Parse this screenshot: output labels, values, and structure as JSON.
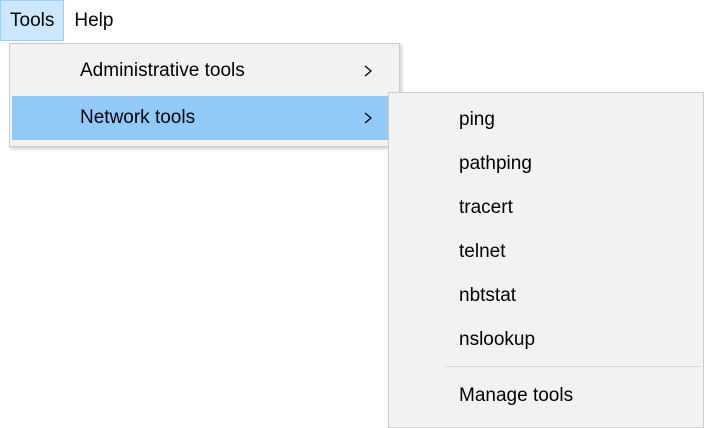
{
  "menubar": {
    "items": [
      {
        "label": "Tools",
        "active": true
      },
      {
        "label": "Help",
        "active": false
      }
    ]
  },
  "tools_menu": {
    "items": [
      {
        "label": "Administrative tools",
        "has_submenu": true,
        "highlighted": false
      },
      {
        "label": "Network tools",
        "has_submenu": true,
        "highlighted": true
      }
    ]
  },
  "network_submenu": {
    "items": [
      {
        "label": "ping"
      },
      {
        "label": "pathping"
      },
      {
        "label": "tracert"
      },
      {
        "label": "telnet"
      },
      {
        "label": "nbtstat"
      },
      {
        "label": "nslookup"
      }
    ],
    "footer_item": {
      "label": "Manage tools"
    }
  },
  "colors": {
    "menubar_active_bg": "#cce8ff",
    "menubar_active_border": "#99d1ff",
    "menu_bg": "#f2f2f2",
    "menu_highlight": "#91c9f7",
    "menu_border": "#cccccc",
    "separator": "#d7d7d7"
  },
  "icons": {
    "submenu_arrow": "chevron-right-icon"
  }
}
